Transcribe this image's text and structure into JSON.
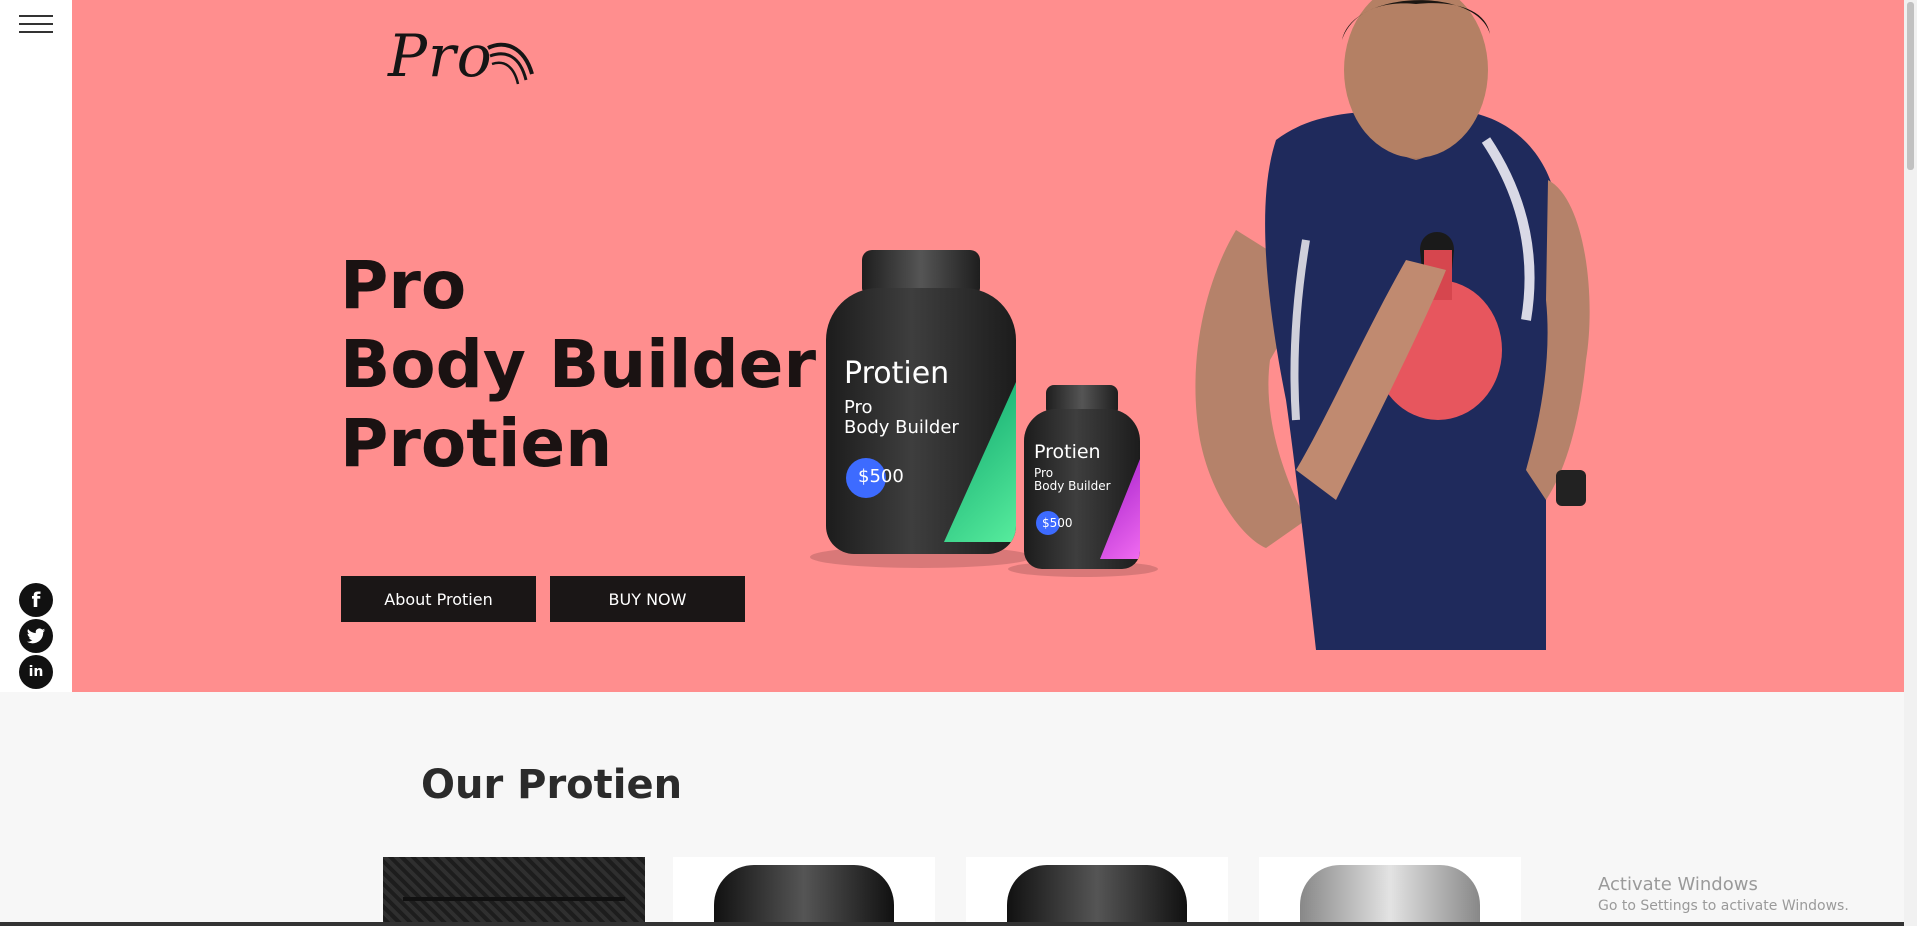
{
  "sidebar": {
    "menu_icon": "hamburger-menu-icon",
    "social": [
      {
        "name": "facebook-icon",
        "glyph": "f"
      },
      {
        "name": "twitter-icon",
        "glyph": "t"
      },
      {
        "name": "linkedin-icon",
        "glyph": "in"
      }
    ]
  },
  "header": {
    "logo_text": "Pro"
  },
  "hero": {
    "title_line1": "Pro",
    "title_line2": "Body Builder",
    "title_line3": "Protien",
    "about_button": "About Protien",
    "buy_button": "BUY NOW",
    "product_large": {
      "name": "Protien",
      "line1": "Pro",
      "line2": "Body Builder",
      "price": "$500"
    },
    "product_small": {
      "name": "Protien",
      "line1": "Pro",
      "line2": "Body Builder",
      "price": "$500"
    }
  },
  "products_section": {
    "title": "Our Protien"
  },
  "watermark": {
    "line1": "Activate Windows",
    "line2": "Go to Settings to activate Windows."
  },
  "colors": {
    "hero_bg": "#ff8e8e",
    "button_bg": "#1a1616",
    "price_badge": "#3d6bff"
  }
}
